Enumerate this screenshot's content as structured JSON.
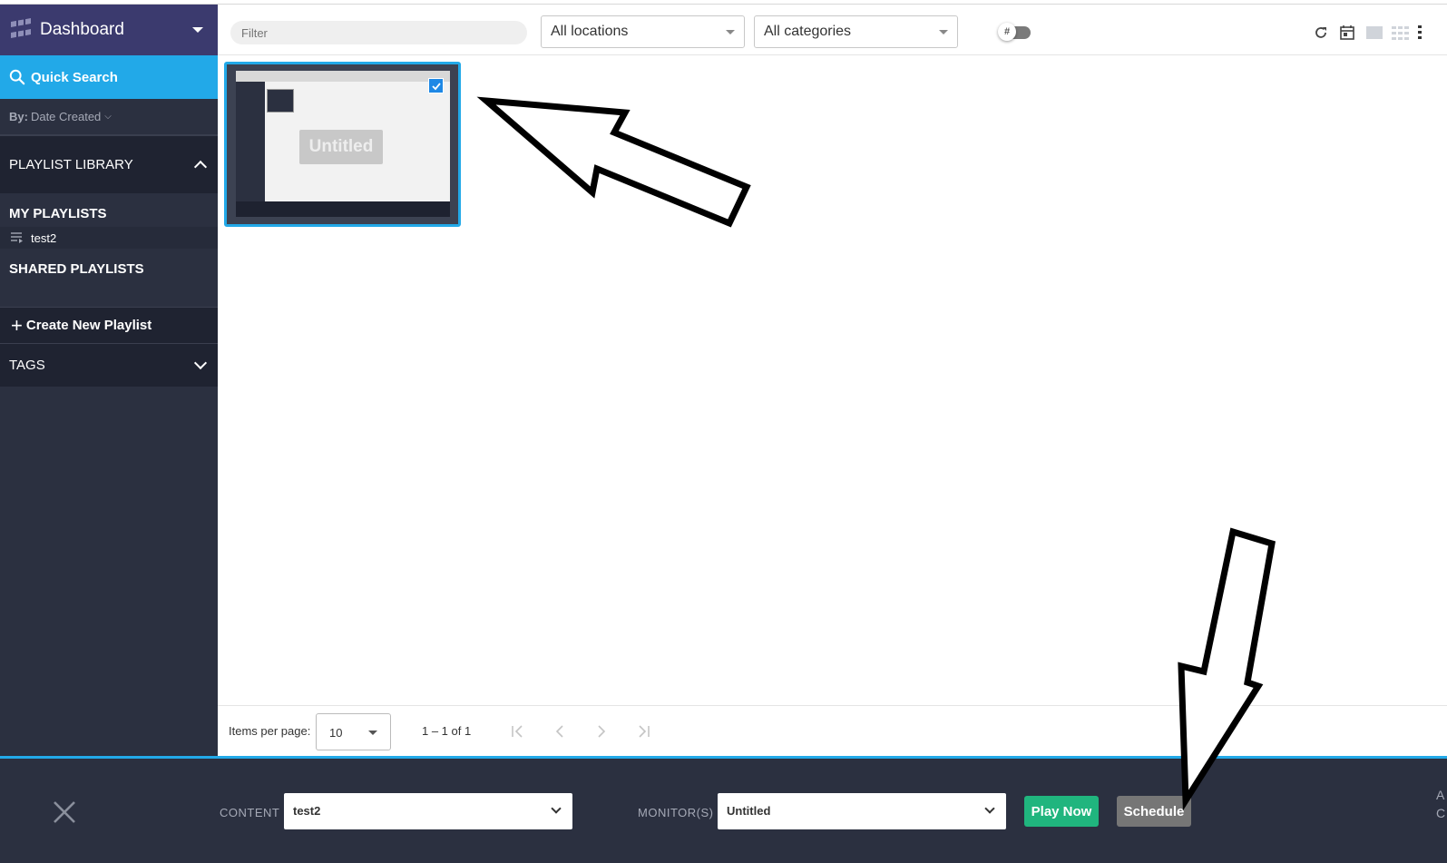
{
  "sidebar": {
    "app_title": "Dashboard",
    "quick_search": "Quick Search",
    "sort_prefix": "By:",
    "sort_value": "Date Created",
    "playlist_library": "PLAYLIST LIBRARY",
    "my_playlists": "MY PLAYLISTS",
    "playlists": [
      {
        "label": "test2"
      }
    ],
    "shared_playlists": "SHARED PLAYLISTS",
    "create_new_playlist": "Create New Playlist",
    "tags": "TAGS"
  },
  "toolbar": {
    "filter_placeholder": "Filter",
    "locations_value": "All locations",
    "categories_value": "All categories",
    "toggle_symbol": "#"
  },
  "grid": {
    "items": [
      {
        "title": "Untitled",
        "selected": true
      }
    ]
  },
  "paginator": {
    "items_per_page_label": "Items per page:",
    "items_per_page_value": "10",
    "range_label": "1 – 1 of 1"
  },
  "bottom_bar": {
    "content_label": "CONTENT",
    "content_value": "test2",
    "monitors_label": "MONITOR(S)",
    "monitors_value": "Untitled",
    "play_now": "Play Now",
    "schedule": "Schedule",
    "edge_text_1": "A",
    "edge_text_2": "C"
  },
  "colors": {
    "sidebar_bg": "#2b3040",
    "header_bg": "#3b3a6e",
    "accent_blue": "#22a9e8",
    "play_green": "#20b57e",
    "schedule_gray": "#767676"
  }
}
